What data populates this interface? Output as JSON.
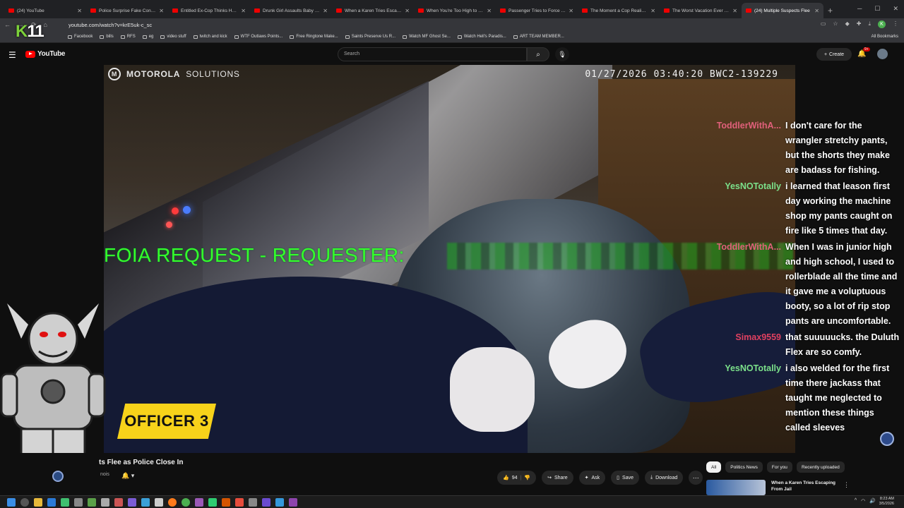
{
  "browser": {
    "tabs": [
      {
        "title": "(24) YouTube"
      },
      {
        "title": "Police Surprise Fake Construction"
      },
      {
        "title": "Entitled Ex-Cop Thinks He's Above"
      },
      {
        "title": "Drunk Girl Assaults Baby Daddy"
      },
      {
        "title": "When a Karen Tries Escaping From"
      },
      {
        "title": "When You're Too High to Realize"
      },
      {
        "title": "Passenger Tries to Force His Way"
      },
      {
        "title": "The Moment a Cop Realizes That"
      },
      {
        "title": "The Worst Vacation Ever - YouTube"
      },
      {
        "title": "(24) Multiple Suspects Flee"
      }
    ],
    "url": "youtube.com/watch?v=krE5uk-c_sc",
    "bookmarks": [
      "Facebook",
      "bills",
      "RFS",
      "eg",
      "video stuff",
      "twitch and kick",
      "WTF Outlaws Points...",
      "Free Ringtone Make...",
      "Saints Preserve Us R...",
      "Watch MF Ghost Se...",
      "Watch Hell's Paradis...",
      "ART TEAM MEMBER..."
    ],
    "all_bookmarks": "All Bookmarks",
    "profile_initial": "K"
  },
  "overlay": {
    "logo_k": "K",
    "logo_num": "11"
  },
  "youtube": {
    "logo_text": "YouTube",
    "search_placeholder": "Search",
    "create_label": "Create",
    "notif_count": "9+"
  },
  "video": {
    "brand_main": "MOTOROLA",
    "brand_sub": "SOLUTIONS",
    "timestamp": "01/27/2026 03:40:20 BWC2-139229",
    "foia_text": "FOIA REQUEST - REQUESTER:",
    "officer_label": "OFFICER 3",
    "title_partial": "ts Flee as Police Close In",
    "channel_partial": "nois",
    "likes": "94"
  },
  "chat": [
    {
      "user": "ToddlerWithA...",
      "color": "#e0607a",
      "text": "I don't care for the wrangler stretchy pants, but the shorts they make are badass for fishing."
    },
    {
      "user": "YesNOTotally",
      "color": "#7be08a",
      "text": "i learned that leason first day working the machine shop my pants caught on fire like 5 times that day."
    },
    {
      "user": "ToddlerWithA...",
      "color": "#e0607a",
      "text": "When I was in junior high and high school, I used to rollerblade all the time and it gave me a voluptuous booty, so a lot of rip stop pants are uncomfortable."
    },
    {
      "user": "Simax9559",
      "color": "#e04060",
      "text": "that suuuuucks. the Duluth Flex are so comfy."
    },
    {
      "user": "YesNOTotally",
      "color": "#7be08a",
      "text": "i also welded for the first time there jackass that taught me neglected to mention these things called sleeves"
    }
  ],
  "actions": {
    "share": "Share",
    "ask": "Ask",
    "save": "Save",
    "download": "Download"
  },
  "chips": [
    "All",
    "Politics News",
    "For you",
    "Recently uploaded"
  ],
  "recommendation": {
    "title": "When a Karen Tries Escaping From Jail"
  },
  "system": {
    "time": "8:23 AM",
    "date": "3/5/2026"
  }
}
